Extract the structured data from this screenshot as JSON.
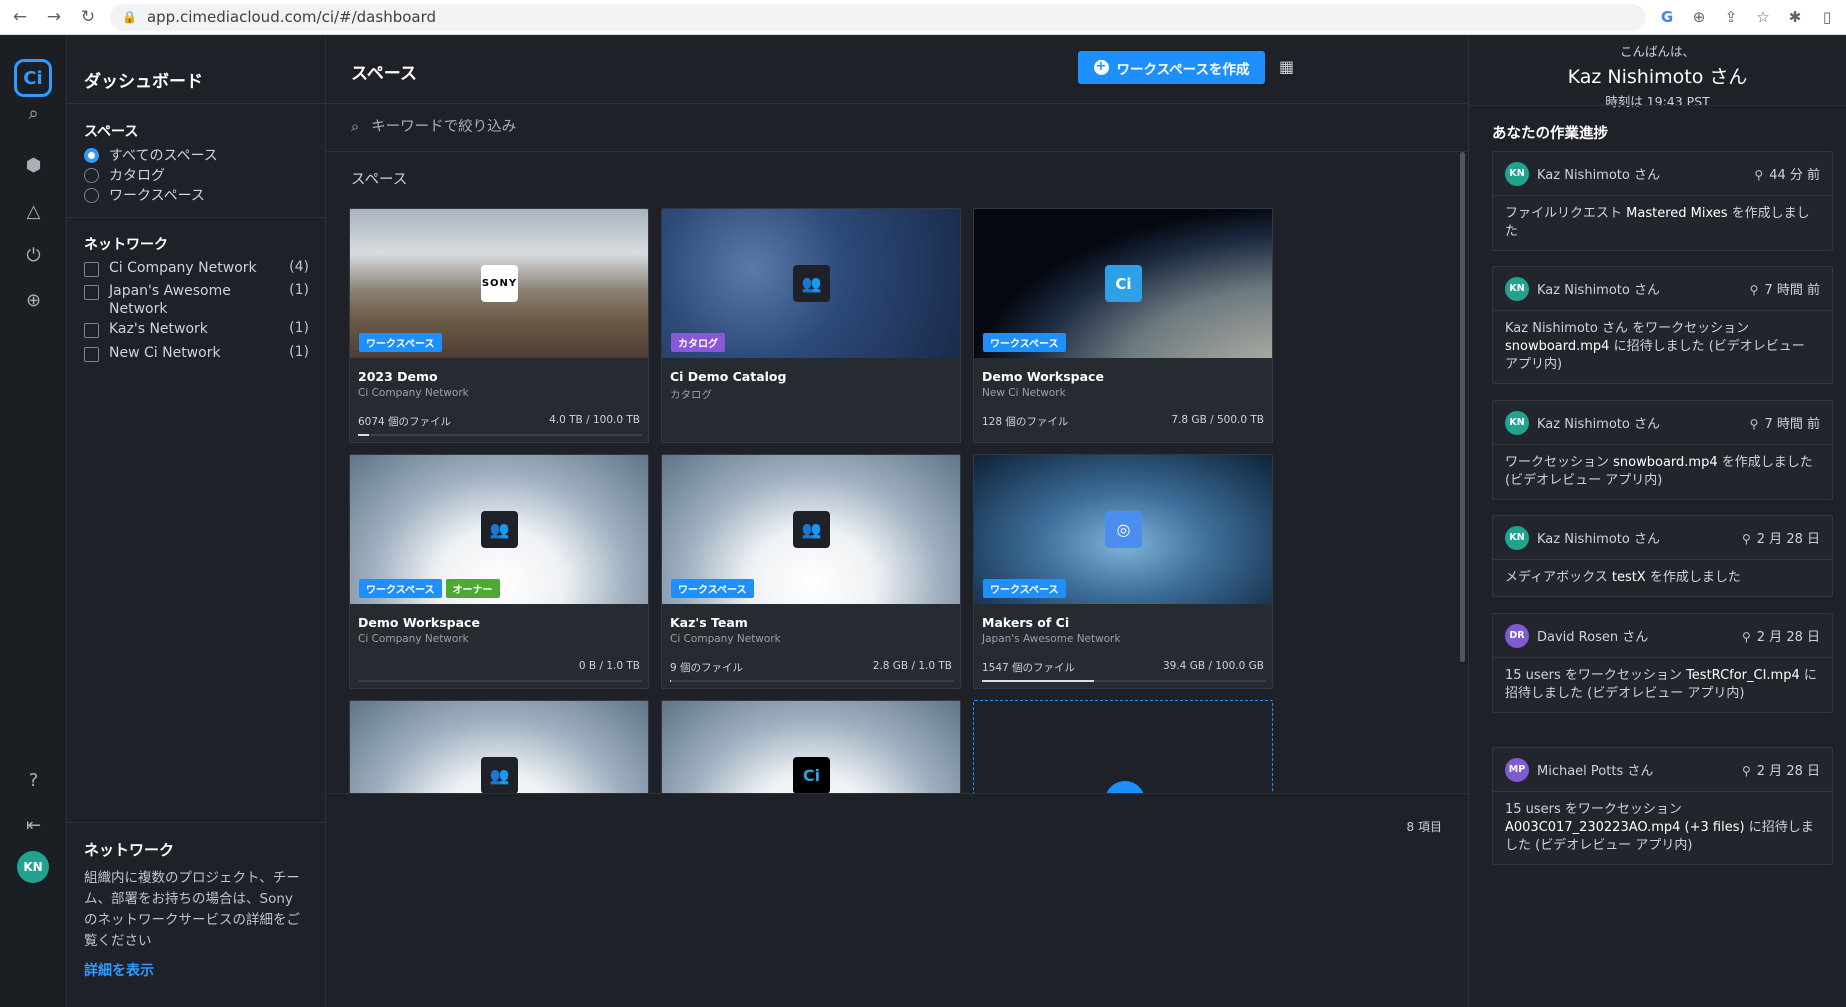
{
  "browser": {
    "url": "app.cimediacloud.com/ci/#/dashboard"
  },
  "rail": {
    "logo": "Ci",
    "avatar": "KN"
  },
  "sidebar": {
    "title": "ダッシュボード",
    "spaces_heading": "スペース",
    "space_filters": [
      "すべてのスペース",
      "カタログ",
      "ワークスペース"
    ],
    "network_heading": "ネットワーク",
    "networks": [
      {
        "name": "Ci Company Network",
        "count": "(4)"
      },
      {
        "name": "Japan's Awesome Network",
        "count": "(1)"
      },
      {
        "name": "Kaz's Network",
        "count": "(1)"
      },
      {
        "name": "New Ci Network",
        "count": "(1)"
      }
    ],
    "footer": {
      "title": "ネットワーク",
      "text": "組織内に複数のプロジェクト、チーム、部署をお持ちの場合は、Sony のネットワークサービスの詳細をご覧ください",
      "link": "詳細を表示"
    }
  },
  "main": {
    "title": "スペース",
    "create_button": "ワークスペースを作成",
    "search_placeholder": "キーワードで絞り込み",
    "section_label": "スペース",
    "item_count": "8 項目",
    "cards": [
      {
        "name": "2023 Demo",
        "network": "Ci Company Network",
        "tags": [
          "ワークスペース"
        ],
        "files": "6074 個のファイル",
        "size": "4.0 TB / 100.0 TB",
        "usage": 0.04
      },
      {
        "name": "Ci Demo Catalog",
        "network": "カタログ",
        "tags": [
          "カタログ"
        ],
        "files": "",
        "size": "",
        "usage": 0
      },
      {
        "name": "Demo Workspace",
        "network": "New Ci Network",
        "tags": [
          "ワークスペース"
        ],
        "files": "128 個のファイル",
        "size": "7.8 GB / 500.0 TB",
        "usage": 0
      },
      {
        "name": "Demo Workspace",
        "network": "Ci Company Network",
        "tags": [
          "ワークスペース",
          "オーナー"
        ],
        "files": "",
        "size": "0 B / 1.0 TB",
        "usage": 0
      },
      {
        "name": "Kaz's Team",
        "network": "Ci Company Network",
        "tags": [
          "ワークスペース"
        ],
        "files": "9 個のファイル",
        "size": "2.8 GB / 1.0 TB",
        "usage": 0.003
      },
      {
        "name": "Makers of Ci",
        "network": "Japan's Awesome Network",
        "tags": [
          "ワークスペース"
        ],
        "files": "1547 個のファイル",
        "size": "39.4 GB / 100.0 GB",
        "usage": 0.394
      }
    ]
  },
  "right": {
    "greeting": "こんばんは、",
    "user_name": "Kaz Nishimoto さん",
    "time": "時刻は 19:43 PST",
    "activity_title": "あなたの作業進捗",
    "activities": [
      {
        "initials": "KN",
        "user": "Kaz Nishimoto さん",
        "when": "44 分 前",
        "text_pre": "ファイルリクエスト ",
        "text_em": "Mastered Mixes",
        "text_post": " を作成しました",
        "color": "#22a38f"
      },
      {
        "initials": "KN",
        "user": "Kaz Nishimoto さん",
        "when": "7 時間 前",
        "text_pre": "Kaz Nishimoto さん をワークセッション ",
        "text_em": "snowboard.mp4",
        "text_post": " に招待しました (ビデオレビュー アプリ内)",
        "color": "#22a38f"
      },
      {
        "initials": "KN",
        "user": "Kaz Nishimoto さん",
        "when": "7 時間 前",
        "text_pre": "ワークセッション ",
        "text_em": "snowboard.mp4",
        "text_post": " を作成しました (ビデオレビュー アプリ内)",
        "color": "#22a38f"
      },
      {
        "initials": "KN",
        "user": "Kaz Nishimoto さん",
        "when": "2 月 28 日",
        "text_pre": "メディアボックス ",
        "text_em": "testX",
        "text_post": " を作成しました",
        "color": "#22a38f"
      },
      {
        "initials": "DR",
        "user": "David Rosen さん",
        "when": "2 月 28 日",
        "text_pre": "15 users をワークセッション ",
        "text_em": "TestRCfor_CI.mp4",
        "text_post": " に招待しました (ビデオレビュー アプリ内)",
        "color": "#7d5bd0"
      },
      {
        "initials": "MP",
        "user": "Michael Potts さん",
        "when": "2 月 28 日",
        "text_pre": "15 users をワークセッション ",
        "text_em": "A003C017_230223AO.mp4 (+3 files)",
        "text_post": " に招待しました (ビデオレビュー アプリ内)",
        "color": "#7d5bd0"
      }
    ]
  }
}
